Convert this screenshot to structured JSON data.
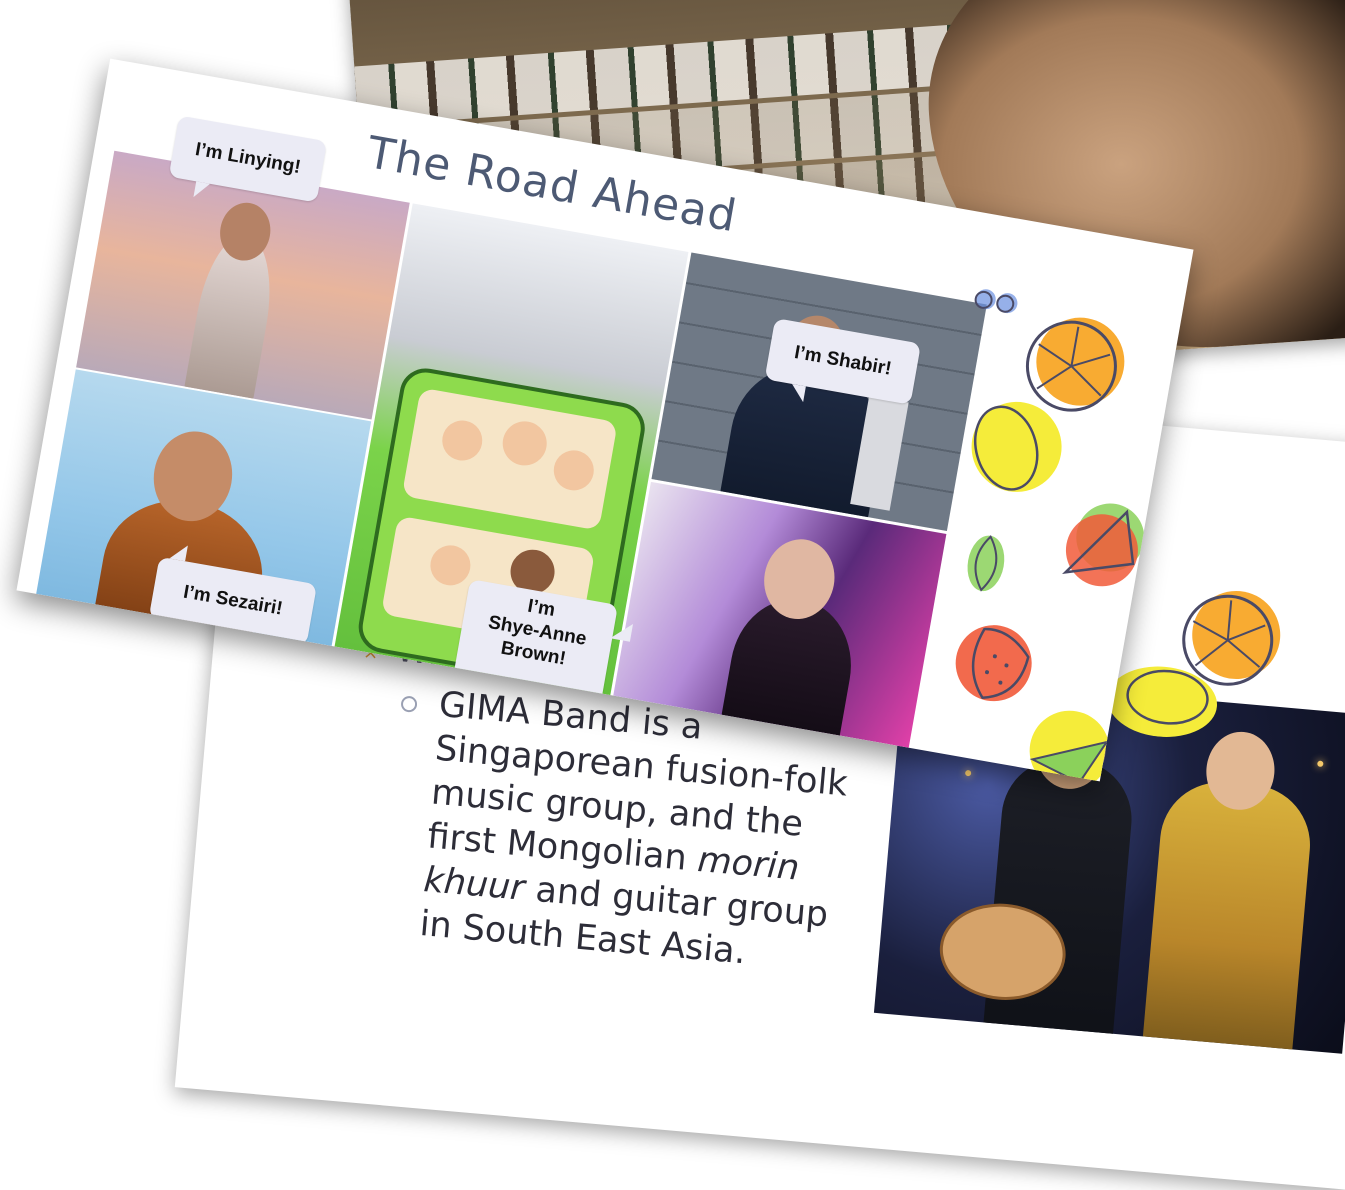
{
  "photo_slide": {
    "description_visible": ""
  },
  "back_slide": {
    "bullet_1": "Who are they?",
    "bullet_2_lines": [
      "GIMA Band is a",
      "Singaporean fusion-folk",
      "music group, and the",
      "first Mongolian ",
      "khuur",
      " and guitar group",
      "in South East Asia."
    ],
    "bullet_2_italic_1": "morin",
    "bullet_marker_1": "×",
    "accent_color": "#e8a13b"
  },
  "front_slide": {
    "title": "The Road Ahead",
    "bubbles": {
      "linying": "I’m Linying!",
      "shabir": "I’m Shabir!",
      "sezairi": "I’m Sezairi!",
      "shye_line1": "I’m",
      "shye_line2": "Shye-Anne",
      "shye_line3": "Brown!"
    },
    "title_color": "#4d5a74",
    "bubble_color": "#ebebf5"
  },
  "icons": [
    "orange-slice-icon",
    "lemon-icon",
    "watermelon-icon",
    "strawberry-icon",
    "lime-slice-icon",
    "leaf-icon",
    "eyes-icon"
  ]
}
